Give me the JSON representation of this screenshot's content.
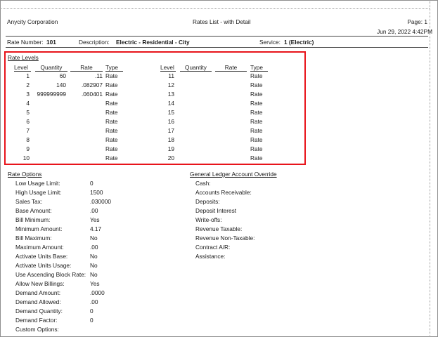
{
  "report": {
    "company": "Anycity Corporation",
    "title": "Rates List - with Detail",
    "page": "Page: 1",
    "datetime": "Jun 29, 2022 4:42PM"
  },
  "rate_header": {
    "rate_number_label": "Rate Number:",
    "rate_number": "101",
    "description_label": "Description:",
    "description": "Electric - Residential - City",
    "service_label": "Service:",
    "service": "1 (Electric)"
  },
  "rate_levels": {
    "section_title": "Rate Levels",
    "headers": {
      "level": "Level",
      "quantity": "Quantity",
      "rate": "Rate",
      "type": "Type"
    },
    "left": [
      {
        "level": "1",
        "quantity": "60",
        "rate": ".11",
        "type": "Rate"
      },
      {
        "level": "2",
        "quantity": "140",
        "rate": ".082907",
        "type": "Rate"
      },
      {
        "level": "3",
        "quantity": "999999999",
        "rate": ".060401",
        "type": "Rate"
      },
      {
        "level": "4",
        "quantity": "",
        "rate": "",
        "type": "Rate"
      },
      {
        "level": "5",
        "quantity": "",
        "rate": "",
        "type": "Rate"
      },
      {
        "level": "6",
        "quantity": "",
        "rate": "",
        "type": "Rate"
      },
      {
        "level": "7",
        "quantity": "",
        "rate": "",
        "type": "Rate"
      },
      {
        "level": "8",
        "quantity": "",
        "rate": "",
        "type": "Rate"
      },
      {
        "level": "9",
        "quantity": "",
        "rate": "",
        "type": "Rate"
      },
      {
        "level": "10",
        "quantity": "",
        "rate": "",
        "type": "Rate"
      }
    ],
    "right": [
      {
        "level": "11",
        "quantity": "",
        "rate": "",
        "type": "Rate"
      },
      {
        "level": "12",
        "quantity": "",
        "rate": "",
        "type": "Rate"
      },
      {
        "level": "13",
        "quantity": "",
        "rate": "",
        "type": "Rate"
      },
      {
        "level": "14",
        "quantity": "",
        "rate": "",
        "type": "Rate"
      },
      {
        "level": "15",
        "quantity": "",
        "rate": "",
        "type": "Rate"
      },
      {
        "level": "16",
        "quantity": "",
        "rate": "",
        "type": "Rate"
      },
      {
        "level": "17",
        "quantity": "",
        "rate": "",
        "type": "Rate"
      },
      {
        "level": "18",
        "quantity": "",
        "rate": "",
        "type": "Rate"
      },
      {
        "level": "19",
        "quantity": "",
        "rate": "",
        "type": "Rate"
      },
      {
        "level": "20",
        "quantity": "",
        "rate": "",
        "type": "Rate"
      }
    ]
  },
  "rate_options": {
    "section_title": "Rate Options",
    "items": [
      {
        "label": "Low Usage Limit:",
        "value": "0"
      },
      {
        "label": "High Usage Limit:",
        "value": "1500"
      },
      {
        "label": "Sales Tax:",
        "value": ".030000"
      },
      {
        "label": "Base Amount:",
        "value": ".00"
      },
      {
        "label": "Bill Minimum:",
        "value": "Yes"
      },
      {
        "label": "Minimum Amount:",
        "value": "4.17"
      },
      {
        "label": "Bill Maximum:",
        "value": "No"
      },
      {
        "label": "Maximum Amount:",
        "value": ".00"
      },
      {
        "label": "Activate Units Base:",
        "value": "No"
      },
      {
        "label": "Activate Units Usage:",
        "value": "No"
      },
      {
        "label": "Use Ascending Block Rate:",
        "value": "No"
      },
      {
        "label": "Allow New Billings:",
        "value": "Yes"
      },
      {
        "label": "Demand Amount:",
        "value": ".0000"
      },
      {
        "label": "Demand Allowed:",
        "value": ".00"
      },
      {
        "label": "Demand Quantity:",
        "value": "0"
      },
      {
        "label": "Demand Factor:",
        "value": "0"
      },
      {
        "label": "Custom Options:",
        "value": ""
      }
    ]
  },
  "gl_override": {
    "section_title": "General Ledger Account Override",
    "items": [
      {
        "label": "Cash:"
      },
      {
        "label": "Accounts Receivable:"
      },
      {
        "label": "Deposits:"
      },
      {
        "label": "Deposit Interest"
      },
      {
        "label": "Write-offs:"
      },
      {
        "label": "Revenue Taxable:"
      },
      {
        "label": "Revenue Non-Taxable:"
      },
      {
        "label": "Contract A/R:"
      },
      {
        "label": "Assistance:"
      }
    ]
  },
  "colors": {
    "highlight": "#e8141b",
    "rule": "#444444"
  }
}
